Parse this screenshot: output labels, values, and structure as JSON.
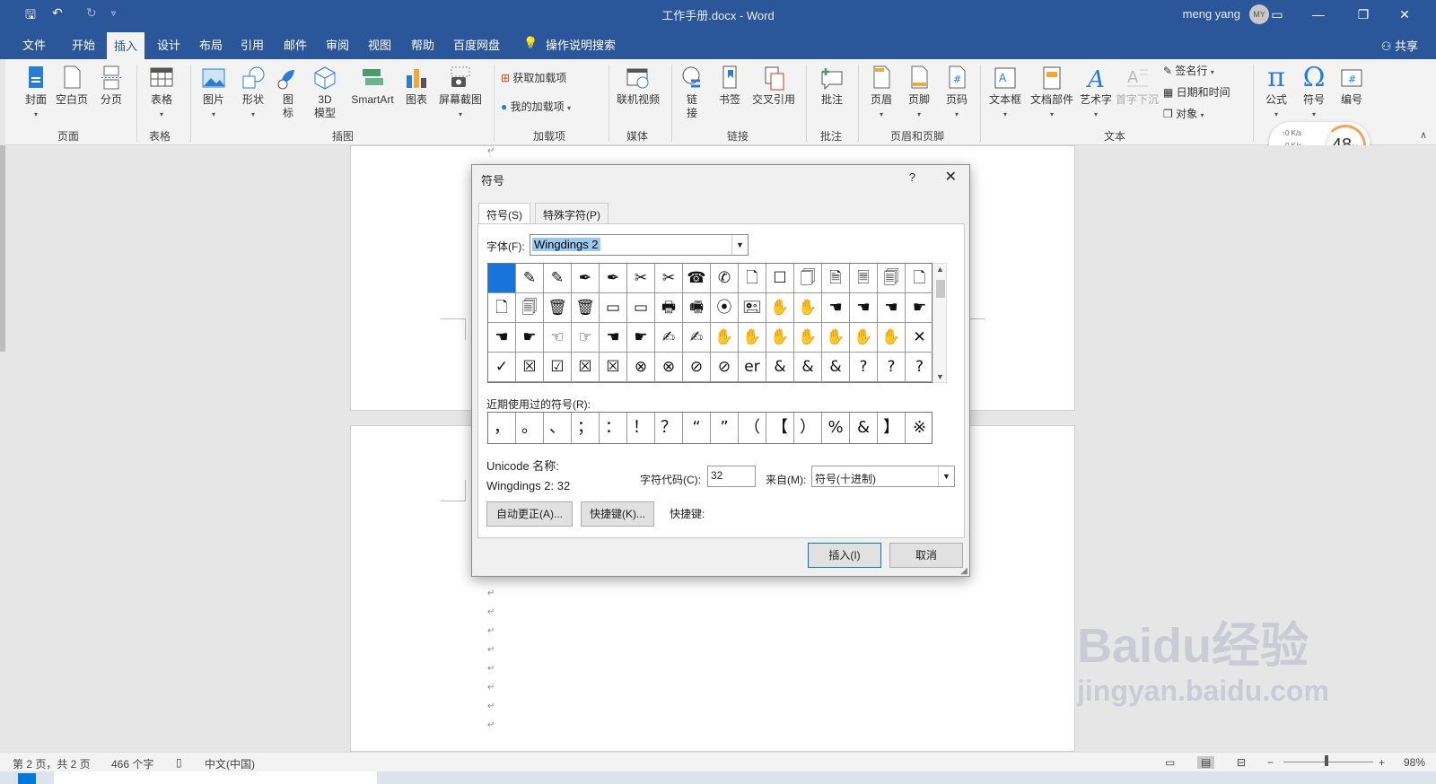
{
  "window": {
    "title": "工作手册.docx  -  Word",
    "user_name": "meng yang",
    "user_initials": "MY"
  },
  "tabs": [
    "文件",
    "开始",
    "插入",
    "设计",
    "布局",
    "引用",
    "邮件",
    "审阅",
    "视图",
    "帮助",
    "百度网盘"
  ],
  "active_tab": "插入",
  "tell_me": "操作说明搜索",
  "share": "共享",
  "ribbon": {
    "page": {
      "cover": "封面",
      "blank": "空白页",
      "break": "分页",
      "group": "页面"
    },
    "table": {
      "table": "表格",
      "group": "表格"
    },
    "illustrations": {
      "picture": "图片",
      "shapes": "形状",
      "icons_l1": "图",
      "icons_l2": "标",
      "model_l1": "3D",
      "model_l2": "模型",
      "smartart": "SmartArt",
      "chart": "图表",
      "screenshot": "屏幕截图",
      "group": "插图"
    },
    "addins": {
      "get": "获取加载项",
      "mine": "我的加载项",
      "group": "加载项"
    },
    "media": {
      "video": "联机视频",
      "group": "媒体"
    },
    "links": {
      "link_l1": "链",
      "link_l2": "接",
      "bookmark": "书签",
      "crossref": "交叉引用",
      "group": "链接"
    },
    "comments": {
      "comment": "批注",
      "group": "批注"
    },
    "header_footer": {
      "header": "页眉",
      "footer": "页脚",
      "page_number": "页码",
      "group": "页眉和页脚"
    },
    "text": {
      "textbox": "文本框",
      "quickparts": "文档部件",
      "wordart": "艺术字",
      "dropcap": "首字下沉",
      "signature": "签名行",
      "datetime": "日期和时间",
      "object": "对象",
      "group": "文本"
    },
    "symbols": {
      "equation": "公式",
      "symbol": "符号",
      "numbering": "编号"
    }
  },
  "speed_widget": {
    "up": "0  K/s",
    "down": "0  K/s",
    "percent": "48",
    "unit": "%"
  },
  "dialog": {
    "title": "符号",
    "help": "?",
    "close": "✕",
    "tab_symbols": "符号(S)",
    "tab_special": "特殊字符(P)",
    "font_label": "字体(F):",
    "font_value": "Wingdings 2",
    "symbols": [
      "",
      "✎",
      "✎",
      "✒",
      "✒",
      "✂",
      "✂",
      "☎",
      "✆",
      "🗋",
      "☐",
      "🗍",
      "🗎",
      "🗏",
      "🗐",
      "🗋",
      "🗋",
      "🗐",
      "🗑",
      "🗑",
      "▭",
      "▭",
      "🖶",
      "🖷",
      "⦿",
      "🖭",
      "✋",
      "✋",
      "☚",
      "☚",
      "☚",
      "☛",
      "☚",
      "☛",
      "☜",
      "☞",
      "☚",
      "☛",
      "✍",
      "✍",
      "✋",
      "✋",
      "✋",
      "✋",
      "✋",
      "✋",
      "✋",
      "✕",
      "✓",
      "☒",
      "☑",
      "☒",
      "☒",
      "⊗",
      "⊗",
      "⊘",
      "⊘",
      "er",
      "&",
      "&",
      "&",
      "?",
      "?",
      "?"
    ],
    "recent_label": "近期使用过的符号(R):",
    "recent": [
      "，",
      "。",
      "、",
      "；",
      "：",
      "！",
      "？",
      "“",
      "”",
      "（",
      "【",
      "）",
      "%",
      "&",
      "】",
      "※"
    ],
    "unicode_name_label": "Unicode 名称:",
    "unicode_name_value": "Wingdings 2: 32",
    "char_code_label": "字符代码(C):",
    "char_code_value": "32",
    "from_label": "来自(M):",
    "from_value": "符号(十进制)",
    "autocorrect": "自动更正(A)...",
    "shortcut_key_button": "快捷键(K)...",
    "shortcut_key_label": "快捷键:",
    "insert": "插入(I)",
    "cancel": "取消"
  },
  "status": {
    "page": "第 2 页，共 2 页",
    "words": "466 个字",
    "language": "中文(中国)",
    "zoom": "98%"
  },
  "watermark": {
    "line1": "Baidu经验",
    "line2": "jingyan.baidu.com"
  }
}
